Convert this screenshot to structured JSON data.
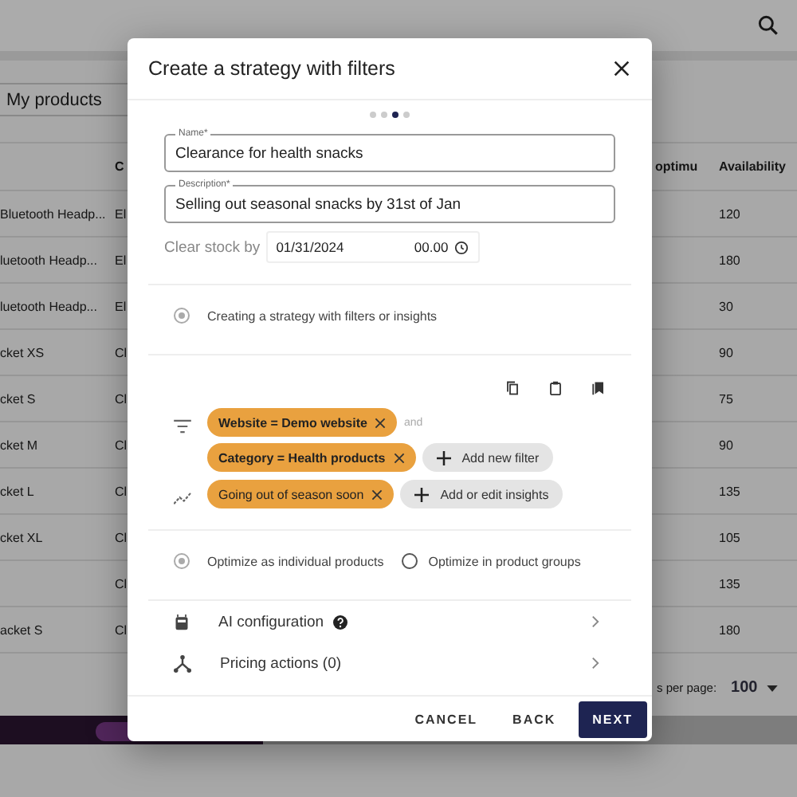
{
  "page": {
    "tab": "My products",
    "table": {
      "columns": [
        "",
        "C",
        "optimu",
        "Availability"
      ],
      "rows": [
        {
          "name": "Bluetooth Headp...",
          "category": "El",
          "availability": "120"
        },
        {
          "name": "luetooth Headp...",
          "category": "El",
          "availability": "180"
        },
        {
          "name": "luetooth Headp...",
          "category": "El",
          "availability": "30"
        },
        {
          "name": "cket XS",
          "category": "Cl",
          "availability": "90"
        },
        {
          "name": "cket S",
          "category": "Cl",
          "availability": "75"
        },
        {
          "name": "cket M",
          "category": "Cl",
          "availability": "90"
        },
        {
          "name": "cket L",
          "category": "Cl",
          "availability": "135"
        },
        {
          "name": "cket XL",
          "category": "Cl",
          "availability": "105"
        },
        {
          "name": "",
          "category": "Cl",
          "availability": "135"
        },
        {
          "name": "acket S",
          "category": "Cl",
          "availability": "180"
        }
      ]
    },
    "pagination": {
      "label": "s per page:",
      "value": "100"
    }
  },
  "dialog": {
    "title": "Create a strategy with filters",
    "steps": [
      {
        "selected": false
      },
      {
        "selected": false
      },
      {
        "selected": true
      },
      {
        "selected": false
      }
    ],
    "name": {
      "label": "Name*",
      "value": "Clearance for health snacks"
    },
    "description": {
      "label": "Description*",
      "value": "Selling out seasonal snacks by 31st of Jan"
    },
    "clear_stock": {
      "label": "Clear stock by",
      "date": "01/31/2024",
      "time": "00.00"
    },
    "strategy_type": {
      "label": "Creating a strategy with filters or insights",
      "selected": true
    },
    "filters": [
      {
        "label": "Website = Demo website"
      },
      {
        "label": "Category = Health products"
      }
    ],
    "filter_joiner": "and",
    "add_filter": "Add new filter",
    "insights": [
      {
        "label": "Going out of season soon"
      }
    ],
    "add_insight": "Add or edit insights",
    "optimize_options": [
      {
        "label": "Optimize as individual products",
        "selected": true
      },
      {
        "label": "Optimize in product groups",
        "selected": false
      }
    ],
    "sections": [
      {
        "kind": "ai",
        "label": "AI configuration",
        "help": true
      },
      {
        "kind": "pricing",
        "label": "Pricing actions (0)",
        "help": false
      }
    ],
    "buttons": [
      {
        "kind": "text",
        "label": "CANCEL"
      },
      {
        "kind": "text",
        "label": "BACK"
      },
      {
        "kind": "primary",
        "label": "NEXT"
      }
    ]
  }
}
